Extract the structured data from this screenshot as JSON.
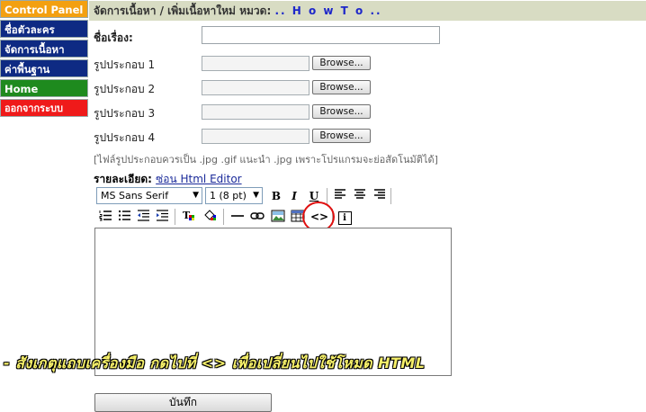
{
  "sidebar": {
    "items": [
      {
        "label": "Control Panel"
      },
      {
        "label": "ชื่อตัวละคร"
      },
      {
        "label": "จัดการเนื้อหา"
      },
      {
        "label": "ค่าพื้นฐาน"
      },
      {
        "label": "Home"
      },
      {
        "label": "ออกจากระบบ"
      }
    ]
  },
  "header": {
    "title": "จัดการเนื้อหา / เพิ่มเนื้อหาใหม่ หมวด:",
    "category": ".. H o w T o .."
  },
  "form": {
    "title_label": "ชื่อเรื่อง:",
    "title_value": "",
    "image_labels": [
      "รูปประกอบ 1",
      "รูปประกอบ 2",
      "รูปประกอบ 3",
      "รูปประกอบ 4"
    ],
    "browse_label": "Browse...",
    "image_note": "[ไฟล์รูปประกอบควรเป็น .jpg .gif แนะนำ .jpg เพราะโปรแกรมจะย่อสัดโนมัติได้]",
    "detail_label": "รายละเอียด:",
    "detail_link": "ซ่อน Html Editor",
    "save_label": "บันทึก"
  },
  "toolbar": {
    "font": "MS Sans Serif",
    "size": "1 (8 pt)",
    "bold": "B",
    "italic": "I",
    "underline": "U",
    "html_mode": "<>",
    "info": "i"
  },
  "annotation": "- สังเกตุแถบเครื่องมือ กดไปที่ <> เพื่อเปลี่ยนไปใช้โหมด HTML",
  "colors": {
    "control_panel": "#f3a011",
    "nav": "#0e2a83",
    "home": "#1e8a1e",
    "logout": "#ef1a1a",
    "header_bg": "#d8dcc3",
    "highlight_circle": "#e01010",
    "annotation_text": "#f7f16a"
  }
}
